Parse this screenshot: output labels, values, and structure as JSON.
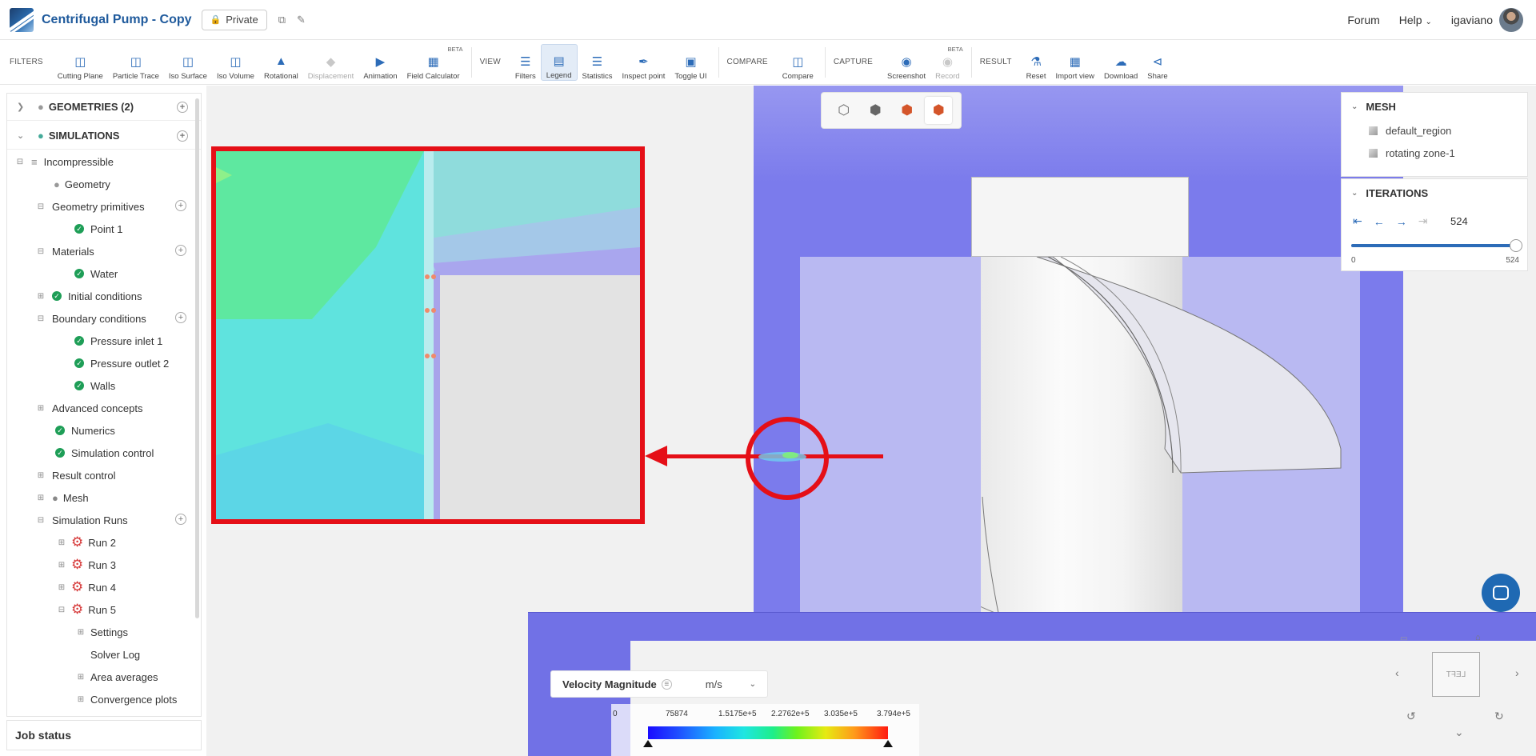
{
  "header": {
    "title": "Centrifugal Pump - Copy",
    "private_label": "Private",
    "forum": "Forum",
    "help": "Help",
    "user": "igaviano"
  },
  "toolbar": {
    "filters_group": "FILTERS",
    "filters": [
      {
        "label": "Cutting Plane",
        "icon": "cutting-plane-icon"
      },
      {
        "label": "Particle Trace",
        "icon": "particle-trace-icon"
      },
      {
        "label": "Iso Surface",
        "icon": "iso-surface-icon"
      },
      {
        "label": "Iso Volume",
        "icon": "iso-volume-icon"
      },
      {
        "label": "Rotational",
        "icon": "rotational-icon"
      },
      {
        "label": "Displacement",
        "icon": "displacement-icon"
      },
      {
        "label": "Animation",
        "icon": "animation-icon"
      },
      {
        "label": "Field Calculator",
        "icon": "field-calculator-icon",
        "badge": "BETA"
      }
    ],
    "view_group": "VIEW",
    "view": [
      {
        "label": "Filters",
        "icon": "filters-icon"
      },
      {
        "label": "Legend",
        "icon": "legend-icon"
      },
      {
        "label": "Statistics",
        "icon": "statistics-icon"
      },
      {
        "label": "Inspect point",
        "icon": "inspect-point-icon"
      },
      {
        "label": "Toggle UI",
        "icon": "toggle-ui-icon"
      }
    ],
    "compare_group": "COMPARE",
    "compare": [
      {
        "label": "Compare",
        "icon": "compare-icon"
      }
    ],
    "capture_group": "CAPTURE",
    "capture": [
      {
        "label": "Screenshot",
        "icon": "camera-icon"
      },
      {
        "label": "Record",
        "icon": "record-icon",
        "badge": "BETA"
      }
    ],
    "result_group": "RESULT",
    "result": [
      {
        "label": "Reset",
        "icon": "reset-icon"
      },
      {
        "label": "Import view",
        "icon": "import-view-icon"
      },
      {
        "label": "Download",
        "icon": "download-icon"
      },
      {
        "label": "Share",
        "icon": "share-icon"
      }
    ]
  },
  "sidebar": {
    "geometries": "GEOMETRIES (2)",
    "simulations": "SIMULATIONS",
    "items": [
      {
        "label": "Incompressible"
      },
      {
        "label": "Geometry"
      },
      {
        "label": "Geometry primitives"
      },
      {
        "label": "Point 1"
      },
      {
        "label": "Materials"
      },
      {
        "label": "Water"
      },
      {
        "label": "Initial conditions"
      },
      {
        "label": "Boundary conditions"
      },
      {
        "label": "Pressure inlet 1"
      },
      {
        "label": "Pressure outlet 2"
      },
      {
        "label": "Walls"
      },
      {
        "label": "Advanced concepts"
      },
      {
        "label": "Numerics"
      },
      {
        "label": "Simulation control"
      },
      {
        "label": "Result control"
      },
      {
        "label": "Mesh"
      },
      {
        "label": "Simulation Runs"
      },
      {
        "label": "Run 2"
      },
      {
        "label": "Run 3"
      },
      {
        "label": "Run 4"
      },
      {
        "label": "Run 5"
      },
      {
        "label": "Settings"
      },
      {
        "label": "Solver Log"
      },
      {
        "label": "Area averages"
      },
      {
        "label": "Convergence plots"
      }
    ],
    "job_status": "Job status"
  },
  "mesh_panel": {
    "title": "MESH",
    "items": [
      "default_region",
      "rotating zone-1"
    ]
  },
  "iterations_panel": {
    "title": "ITERATIONS",
    "value": "524",
    "min": "0",
    "max": "524",
    "fraction": 1.0
  },
  "legend": {
    "field": "Velocity Magnitude",
    "unit": "m/s",
    "ticks": [
      "0",
      "75874",
      "1.5175e+5",
      "2.2762e+5",
      "3.035e+5",
      "3.794e+5"
    ]
  },
  "nav_cube": {
    "face": "LEFT"
  },
  "colors": {
    "brand": "#1f5a9c",
    "highlight": "#e50f17",
    "fluid": "#7b7bec"
  }
}
